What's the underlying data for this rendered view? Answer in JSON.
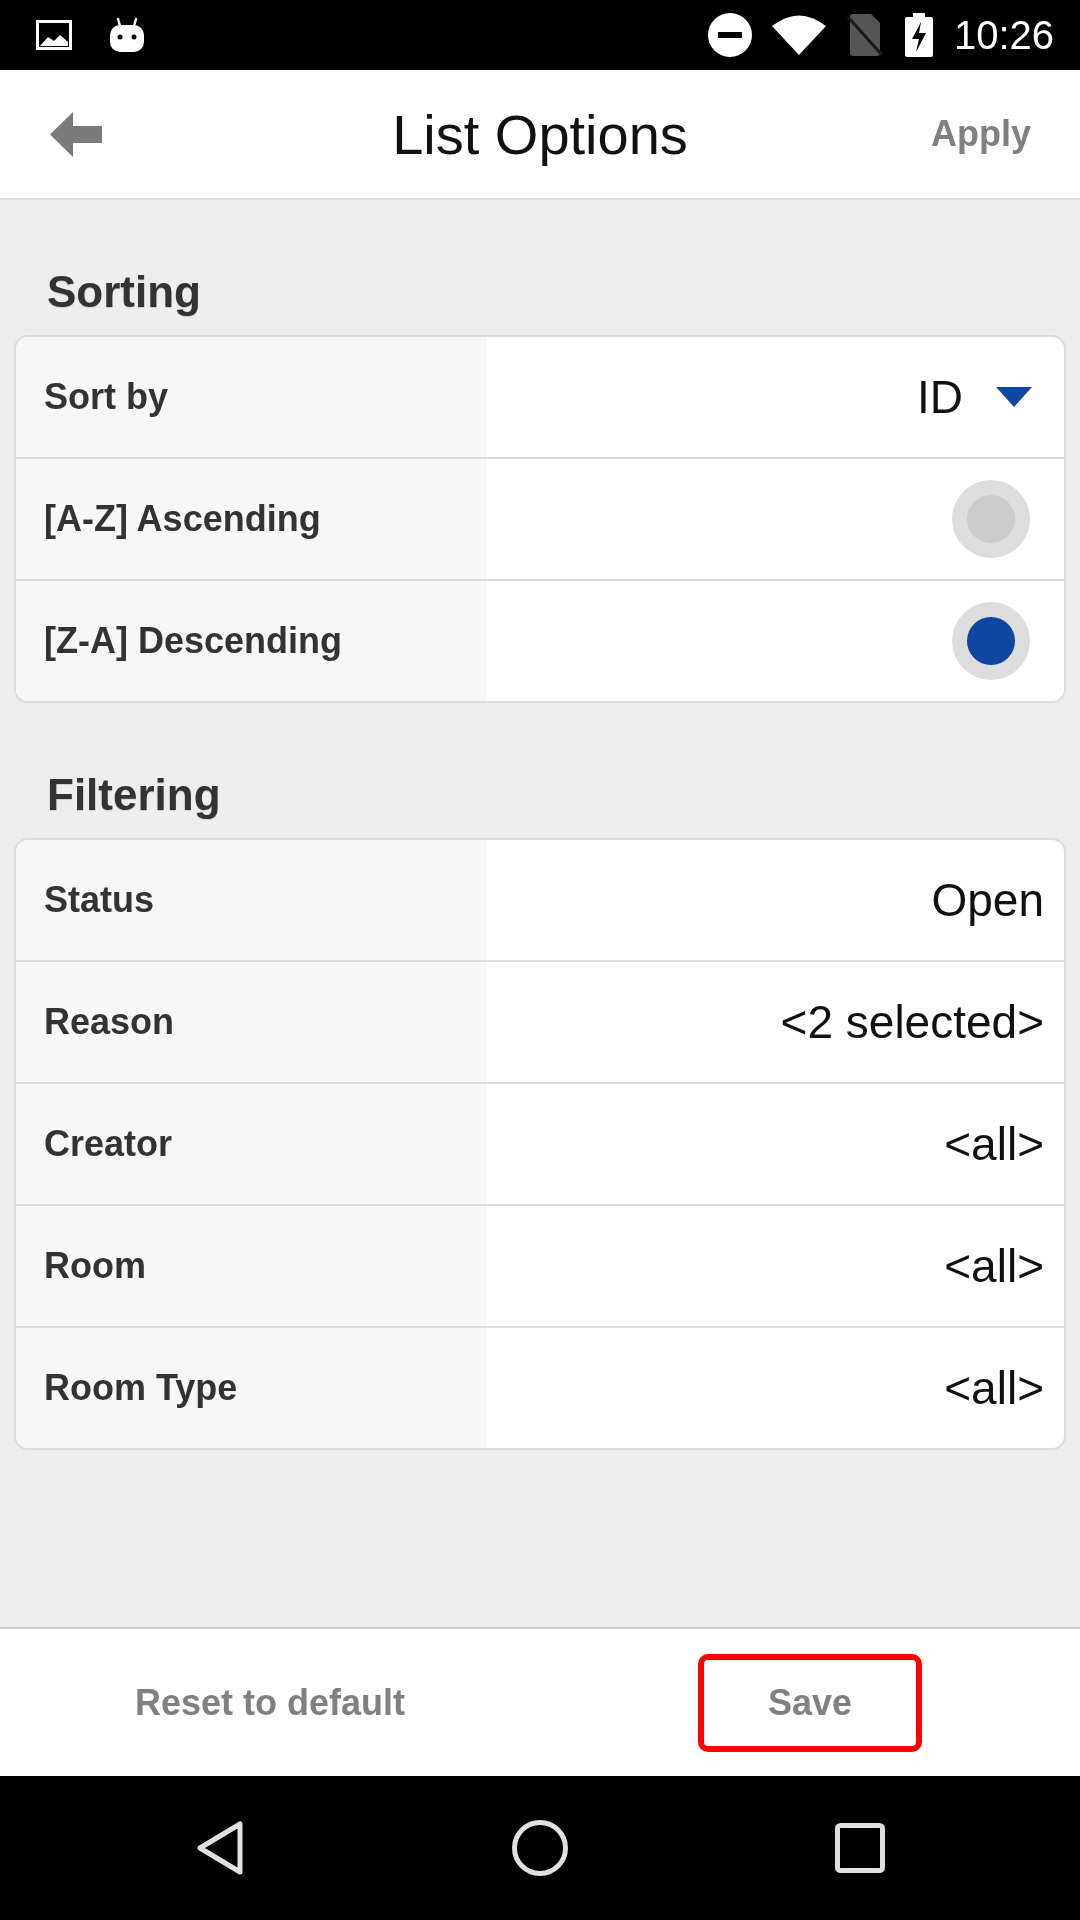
{
  "status_bar": {
    "time": "10:26"
  },
  "header": {
    "title": "List Options",
    "action": "Apply"
  },
  "sections": [
    {
      "title": "Sorting",
      "rows": [
        {
          "kind": "dropdown",
          "label": "Sort by",
          "value": "ID"
        },
        {
          "kind": "radio",
          "label": "[A-Z] Ascending",
          "selected": false
        },
        {
          "kind": "radio",
          "label": "[Z-A] Descending",
          "selected": true
        }
      ]
    },
    {
      "title": "Filtering",
      "rows": [
        {
          "kind": "value",
          "label": "Status",
          "value": "Open"
        },
        {
          "kind": "value",
          "label": "Reason",
          "value": "<2 selected>"
        },
        {
          "kind": "value",
          "label": "Creator",
          "value": "<all>"
        },
        {
          "kind": "value",
          "label": "Room",
          "value": "<all>"
        },
        {
          "kind": "value",
          "label": "Room Type",
          "value": "<all>"
        }
      ]
    }
  ],
  "footer": {
    "buttons": [
      {
        "label": "Reset to default",
        "highlighted": false
      },
      {
        "label": "Save",
        "highlighted": true
      }
    ]
  }
}
